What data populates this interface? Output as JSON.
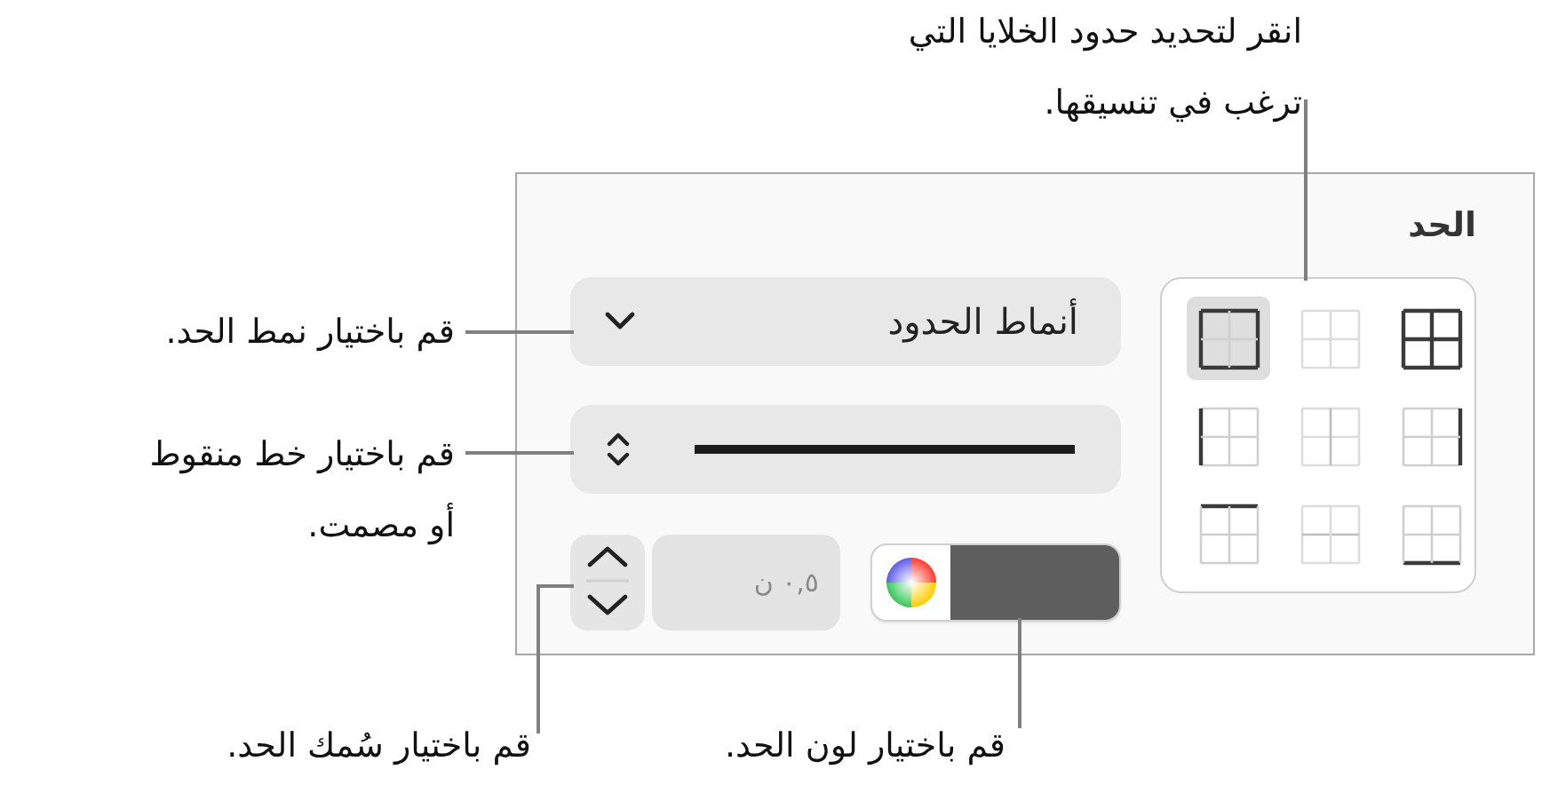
{
  "panel": {
    "title": "الحد",
    "border_styles": [
      {
        "kind": "outer",
        "selected": true
      },
      {
        "kind": "inner",
        "selected": false
      },
      {
        "kind": "all",
        "selected": false
      },
      {
        "kind": "left",
        "selected": false
      },
      {
        "kind": "inner-vertical",
        "selected": false
      },
      {
        "kind": "right",
        "selected": false
      },
      {
        "kind": "top",
        "selected": false
      },
      {
        "kind": "inner-horizontal",
        "selected": false
      },
      {
        "kind": "bottom",
        "selected": false
      }
    ],
    "style_popup": {
      "label": "أنماط الحدود"
    },
    "line_style": {
      "kind": "solid"
    },
    "width_field": {
      "value": "٠,٥ ن"
    },
    "color_well": {
      "color": "#5e5e5e"
    }
  },
  "callouts": {
    "cell_borders": [
      "انقر لتحديد حدود الخلايا التي",
      "ترغب في تنسيقها."
    ],
    "border_style": [
      "قم باختيار نمط الحد."
    ],
    "line_style": [
      "قم باختيار خط منقوط",
      "أو مصمت."
    ],
    "border_width": [
      "قم باختيار سُمك الحد."
    ],
    "border_color": [
      "قم باختيار لون الحد."
    ]
  }
}
